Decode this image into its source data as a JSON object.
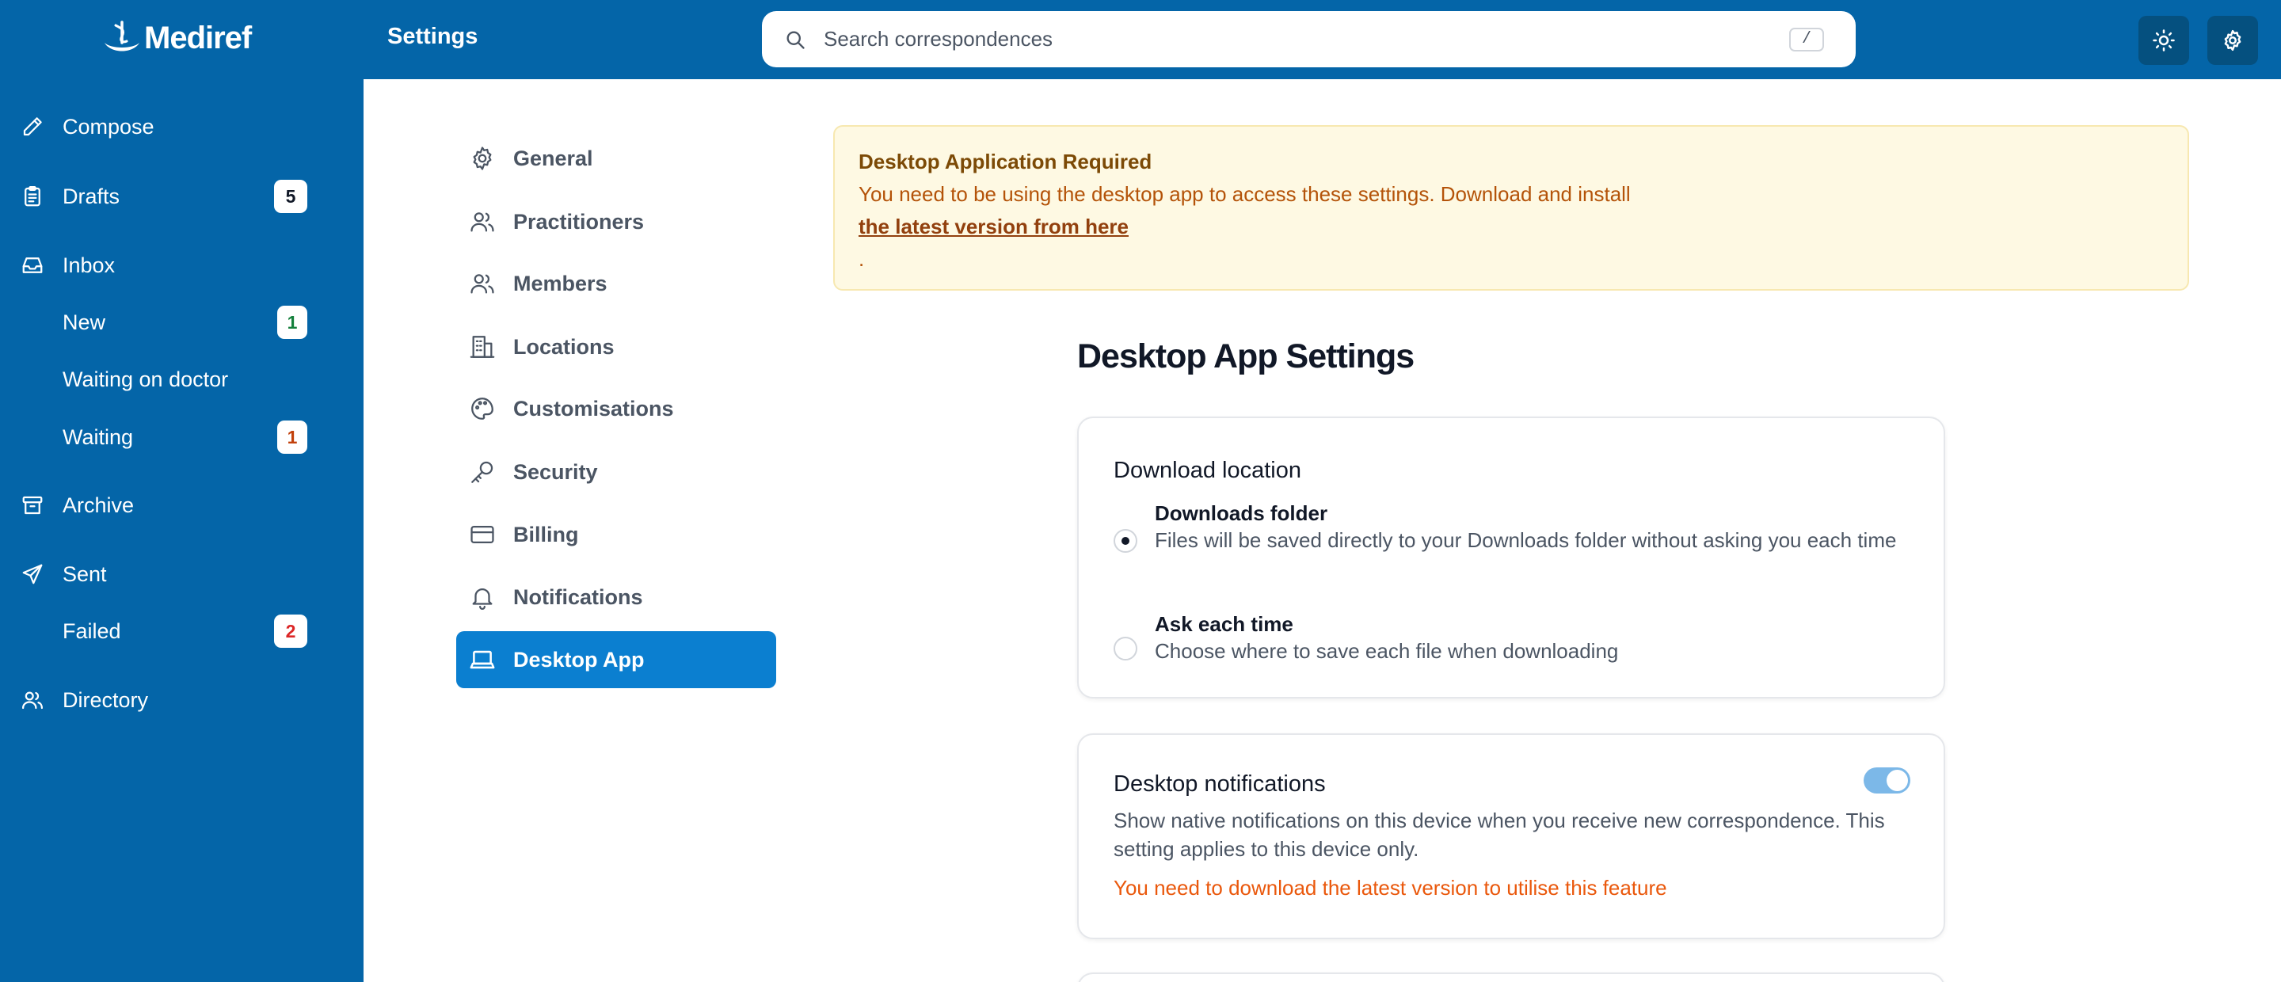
{
  "app": {
    "name": "Mediref"
  },
  "header": {
    "title": "Settings",
    "search": {
      "placeholder": "Search correspondences",
      "shortcut": "/"
    },
    "buttons": [
      "theme-toggle",
      "settings"
    ]
  },
  "sidebar": {
    "compose": {
      "label": "Compose",
      "icon": "pencil-icon"
    },
    "drafts": {
      "label": "Drafts",
      "count": "5",
      "icon": "clipboard-icon"
    },
    "inbox": {
      "label": "Inbox",
      "icon": "inbox-icon",
      "new": {
        "label": "New",
        "count": "1"
      },
      "waiting_doctor": {
        "label": "Waiting on doctor"
      },
      "waiting": {
        "label": "Waiting",
        "count": "1"
      }
    },
    "archive": {
      "label": "Archive",
      "icon": "archive-icon"
    },
    "sent": {
      "label": "Sent",
      "icon": "send-icon",
      "failed": {
        "label": "Failed",
        "count": "2"
      }
    },
    "directory": {
      "label": "Directory",
      "icon": "users-icon"
    }
  },
  "settings_menu": [
    {
      "label": "General",
      "icon": "gear-icon"
    },
    {
      "label": "Practitioners",
      "icon": "users-icon"
    },
    {
      "label": "Members",
      "icon": "users-icon"
    },
    {
      "label": "Locations",
      "icon": "building-icon"
    },
    {
      "label": "Customisations",
      "icon": "palette-icon"
    },
    {
      "label": "Security",
      "icon": "key-icon"
    },
    {
      "label": "Billing",
      "icon": "credit-card-icon"
    },
    {
      "label": "Notifications",
      "icon": "bell-icon"
    },
    {
      "label": "Desktop App",
      "icon": "laptop-icon",
      "active": true
    }
  ],
  "alert": {
    "title": "Desktop Application Required",
    "message": "You need to be using the desktop app to access these settings. Download and install",
    "link": "the latest version from here",
    "suffix": "."
  },
  "main": {
    "title": "Desktop App Settings",
    "download_location": {
      "title": "Download location",
      "options": [
        {
          "label": "Downloads folder",
          "description": "Files will be saved directly to your Downloads folder without asking you each time",
          "selected": true
        },
        {
          "label": "Ask each time",
          "description": "Choose where to save each file when downloading",
          "selected": false
        }
      ]
    },
    "notifications": {
      "title": "Desktop notifications",
      "description": "Show native notifications on this device when you receive new correspondence. This setting applies to this device only.",
      "warning": "You need to download the latest version to utilise this feature",
      "enabled": true
    }
  },
  "colors": {
    "brand": "#0465a8",
    "active_item": "#0b7fd0",
    "badge_green": "#15803d",
    "badge_orange": "#c2410c",
    "badge_red": "#dc2626",
    "warning": "#ea580c",
    "alert_bg": "#fef9e3"
  }
}
